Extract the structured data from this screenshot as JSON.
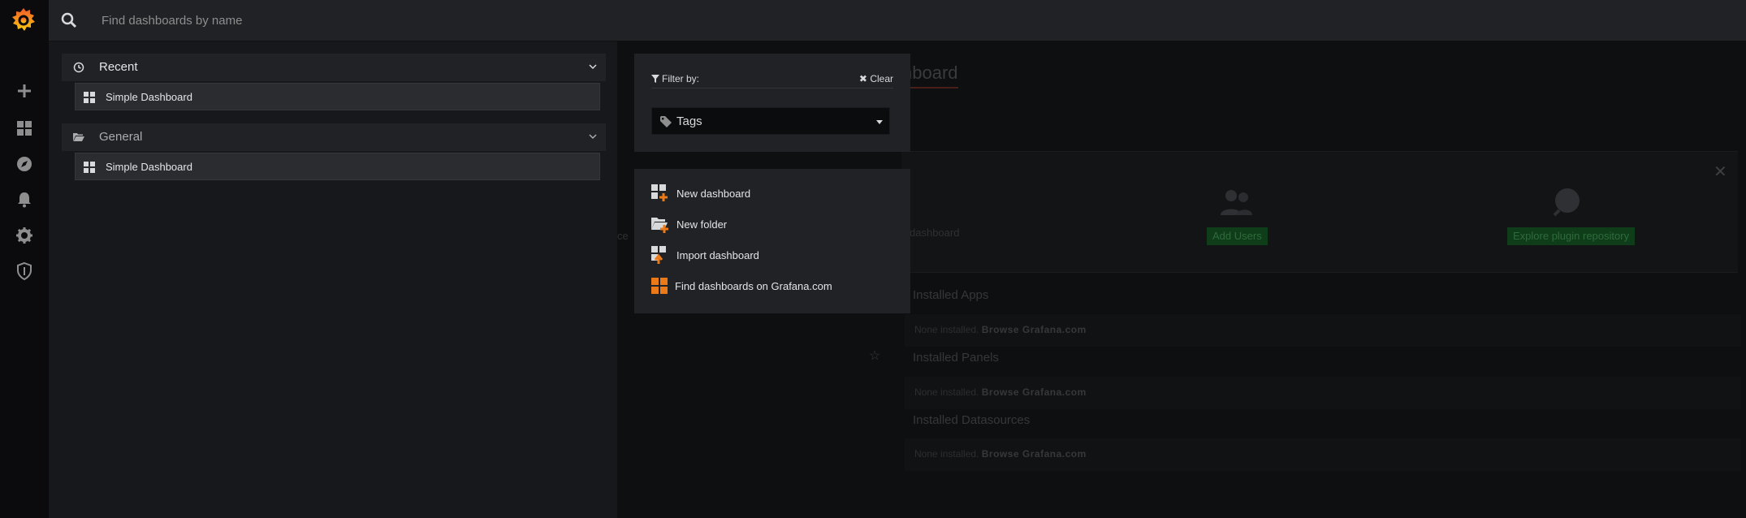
{
  "search": {
    "placeholder": "Find dashboards by name"
  },
  "rail": {
    "icons": [
      "grafana-logo",
      "plus-icon",
      "dashboards-icon",
      "explore-icon",
      "alerting-bell-icon",
      "configuration-gear-icon",
      "server-admin-shield-icon"
    ]
  },
  "results": {
    "sections": [
      {
        "title": "Recent",
        "icon": "clock-icon",
        "expanded": true,
        "items": [
          {
            "title": "Simple Dashboard"
          }
        ]
      },
      {
        "title": "General",
        "icon": "folder-open-icon",
        "expanded": true,
        "items": [
          {
            "title": "Simple Dashboard"
          }
        ]
      }
    ]
  },
  "filter": {
    "label": "Filter by:",
    "clear_label": "Clear",
    "tags_label": "Tags"
  },
  "actions": {
    "items": [
      {
        "label": "New dashboard",
        "icon": "new-dashboard-icon"
      },
      {
        "label": "New folder",
        "icon": "new-folder-icon"
      },
      {
        "label": "Import dashboard",
        "icon": "import-dashboard-icon"
      },
      {
        "label": "Find dashboards on Grafana.com",
        "icon": "grafana-com-dashboards-icon"
      }
    ]
  },
  "background": {
    "title_fragment": "shboard",
    "cut_label_left": "ce",
    "cut_label_dashboard": "dashboard",
    "add_users": "Add Users",
    "explore_plugins": "Explore plugin repository",
    "installed_apps": "Installed Apps",
    "installed_panels": "Installed Panels",
    "installed_datasources": "Installed Datasources",
    "none_installed": "None installed.",
    "browse_link": "Browse Grafana.com"
  },
  "colors": {
    "accent_orange": "#eb7b18",
    "panel_bg": "#202226",
    "results_bg": "#17181b",
    "rail_bg": "#0b0b0d"
  }
}
